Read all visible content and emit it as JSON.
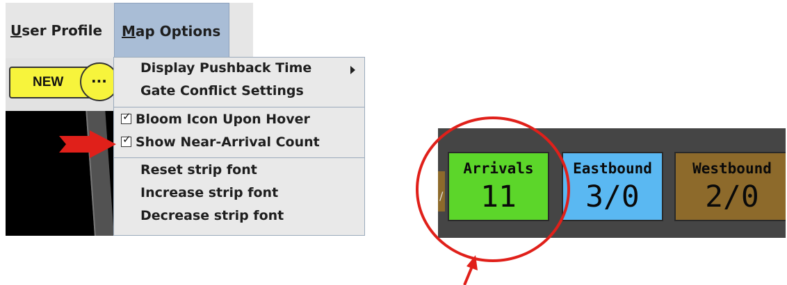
{
  "menubar": {
    "user_profile": {
      "mnemonic": "U",
      "rest": "ser Profile"
    },
    "map_options": {
      "mnemonic": "M",
      "rest": "ap Options"
    }
  },
  "toolbar": {
    "new_label": "NEW",
    "more_label": "..."
  },
  "map_options_menu": {
    "items": [
      {
        "label": "Display Pushback Time",
        "has_submenu": true
      },
      {
        "label": "Gate Conflict Settings"
      },
      {
        "label": "Bloom Icon Upon Hover",
        "checked": true
      },
      {
        "label": "Show Near-Arrival Count",
        "checked": true
      },
      {
        "label": "Reset strip font"
      },
      {
        "label": "Increase strip font"
      },
      {
        "label": "Decrease strip font"
      }
    ]
  },
  "status_panel": {
    "edge_mark": "/",
    "tiles": [
      {
        "label": "Arrivals",
        "value": "11",
        "color": "#5cd62a"
      },
      {
        "label": "Eastbound",
        "value": "3/0",
        "color": "#5ab8f2"
      },
      {
        "label": "Westbound",
        "value": "2/0",
        "color": "#8d6a2b"
      }
    ]
  },
  "annotation_colors": {
    "highlight": "#e0201a"
  }
}
